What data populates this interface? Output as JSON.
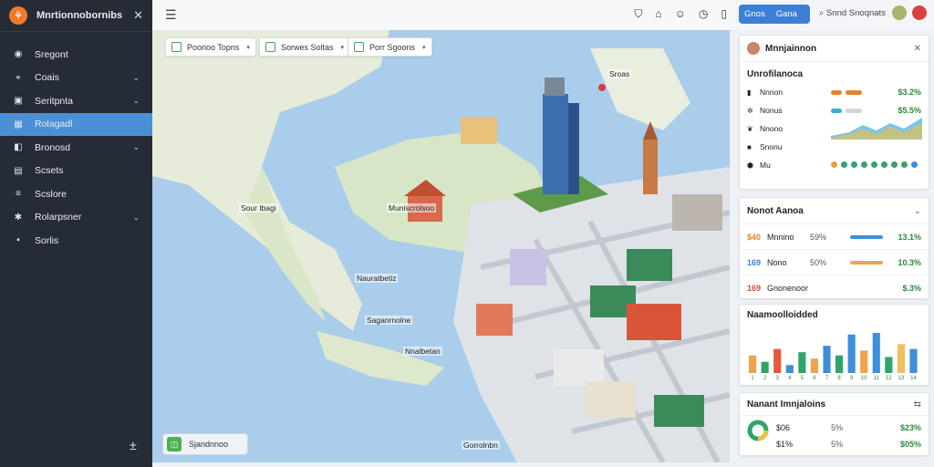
{
  "sidebar": {
    "brand": "Mnrtionnobornibs",
    "items": [
      {
        "label": "Sregont",
        "icon": "dashboard-icon",
        "chev": false,
        "active": false
      },
      {
        "label": "Coais",
        "icon": "pin-icon",
        "chev": true,
        "active": false
      },
      {
        "label": "Seritpnta",
        "icon": "briefcase-icon",
        "chev": true,
        "active": false
      },
      {
        "label": "Rolagadl",
        "icon": "calendar-icon",
        "chev": false,
        "active": true
      },
      {
        "label": "Bronosd",
        "icon": "layers-icon",
        "chev": true,
        "active": false
      },
      {
        "label": "Scsets",
        "icon": "chart-icon",
        "chev": false,
        "active": false
      },
      {
        "label": "Scslore",
        "icon": "sliders-icon",
        "chev": false,
        "active": false
      },
      {
        "label": "Rolarpsner",
        "icon": "settings-icon",
        "chev": true,
        "active": false
      },
      {
        "label": "Sorlis",
        "icon": "box-icon",
        "chev": false,
        "active": false
      }
    ]
  },
  "topbar": {
    "icons": [
      "shield-icon",
      "home-icon",
      "smile-icon",
      "clock-icon",
      "phone-icon"
    ]
  },
  "filters": [
    {
      "label": "Poorioo Topns"
    },
    {
      "label": "Sorwes Soltas"
    },
    {
      "label": "Porr Sgoons"
    }
  ],
  "map_labels": {
    "city1": "Sour tbagi",
    "city2": "Muniscrolsoo",
    "city3": "Nauratbetiz",
    "city4": "Saganrnolne",
    "city5": "Nnalbetan",
    "bottom": "Gorrolnbn",
    "tag1": "Sroas"
  },
  "bottom_pill": {
    "label": "Sjandnnoo"
  },
  "right_top": {
    "button_a": "Gnos",
    "button_b": "Gana",
    "search": "Snnd Snoqnats"
  },
  "card_legend": {
    "user": "Mnnjainnon",
    "title": "Unrofilanoca",
    "rows": [
      {
        "name": "Nnnon",
        "value": "$3.2%",
        "icon": "bars-icon"
      },
      {
        "name": "Nonus",
        "value": "$5.5%",
        "icon": "gear-icon"
      },
      {
        "name": "Nnono",
        "value": "",
        "icon": "leaf-icon"
      },
      {
        "name": "Snonu",
        "value": "",
        "icon": "square-icon"
      },
      {
        "name": "Mu",
        "value": "",
        "icon": "hex-icon"
      }
    ]
  },
  "card_stats": {
    "title": "Nonot Aanoa",
    "rows": [
      {
        "key": "$40",
        "name": "Mnnino",
        "pct": "59%",
        "value": "13.1%",
        "color": "#e8822e",
        "barcolor": "#3d8fd9"
      },
      {
        "key": "169",
        "name": "Nono",
        "pct": "50%",
        "value": "10.3%",
        "color": "#3d7fd6",
        "barcolor": "#f0a44a"
      },
      {
        "key": "169",
        "name": "Gnonenoor",
        "pct": "",
        "value": "$.3%",
        "color": "#d94a38",
        "barcolor": ""
      }
    ]
  },
  "card_chart": {
    "title": "Naamoolloidded"
  },
  "card_summary": {
    "title": "Nanant Imnjaloins",
    "rows": [
      {
        "name": "$06",
        "pct": "5%",
        "value": "$23%"
      },
      {
        "name": "$1%",
        "pct": "5%",
        "value": "$05%"
      }
    ]
  },
  "colors": {
    "sidebar": "#252c36",
    "active": "#4a90d6",
    "accent": "#3d7fd6",
    "positive": "#2b8a3e"
  },
  "chart_data": {
    "type": "bar",
    "title": "Naamoolloidded",
    "categories": [
      "1",
      "2",
      "3",
      "4",
      "5",
      "6",
      "7",
      "8",
      "9",
      "10",
      "11",
      "12",
      "13",
      "14"
    ],
    "series": [
      {
        "values": [
          22,
          14,
          30,
          10,
          26,
          18,
          34,
          22,
          48,
          28,
          50,
          20,
          36,
          30
        ]
      }
    ],
    "colors": [
      "#f0a44a",
      "#2fa56a",
      "#e55a3a",
      "#3d8fd9",
      "#2fa56a",
      "#f0a44a",
      "#3d8fd9",
      "#2fa56a",
      "#3d8fd9",
      "#f0a44a",
      "#3d8fd9",
      "#2fa56a",
      "#f0c060",
      "#3d8fd9"
    ]
  }
}
